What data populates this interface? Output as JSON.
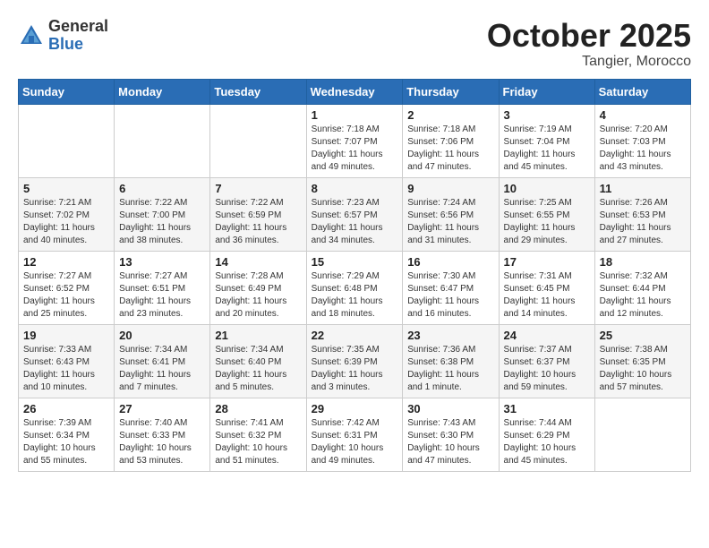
{
  "header": {
    "logo_general": "General",
    "logo_blue": "Blue",
    "month": "October 2025",
    "location": "Tangier, Morocco"
  },
  "weekdays": [
    "Sunday",
    "Monday",
    "Tuesday",
    "Wednesday",
    "Thursday",
    "Friday",
    "Saturday"
  ],
  "weeks": [
    [
      {
        "day": "",
        "info": ""
      },
      {
        "day": "",
        "info": ""
      },
      {
        "day": "",
        "info": ""
      },
      {
        "day": "1",
        "info": "Sunrise: 7:18 AM\nSunset: 7:07 PM\nDaylight: 11 hours\nand 49 minutes."
      },
      {
        "day": "2",
        "info": "Sunrise: 7:18 AM\nSunset: 7:06 PM\nDaylight: 11 hours\nand 47 minutes."
      },
      {
        "day": "3",
        "info": "Sunrise: 7:19 AM\nSunset: 7:04 PM\nDaylight: 11 hours\nand 45 minutes."
      },
      {
        "day": "4",
        "info": "Sunrise: 7:20 AM\nSunset: 7:03 PM\nDaylight: 11 hours\nand 43 minutes."
      }
    ],
    [
      {
        "day": "5",
        "info": "Sunrise: 7:21 AM\nSunset: 7:02 PM\nDaylight: 11 hours\nand 40 minutes."
      },
      {
        "day": "6",
        "info": "Sunrise: 7:22 AM\nSunset: 7:00 PM\nDaylight: 11 hours\nand 38 minutes."
      },
      {
        "day": "7",
        "info": "Sunrise: 7:22 AM\nSunset: 6:59 PM\nDaylight: 11 hours\nand 36 minutes."
      },
      {
        "day": "8",
        "info": "Sunrise: 7:23 AM\nSunset: 6:57 PM\nDaylight: 11 hours\nand 34 minutes."
      },
      {
        "day": "9",
        "info": "Sunrise: 7:24 AM\nSunset: 6:56 PM\nDaylight: 11 hours\nand 31 minutes."
      },
      {
        "day": "10",
        "info": "Sunrise: 7:25 AM\nSunset: 6:55 PM\nDaylight: 11 hours\nand 29 minutes."
      },
      {
        "day": "11",
        "info": "Sunrise: 7:26 AM\nSunset: 6:53 PM\nDaylight: 11 hours\nand 27 minutes."
      }
    ],
    [
      {
        "day": "12",
        "info": "Sunrise: 7:27 AM\nSunset: 6:52 PM\nDaylight: 11 hours\nand 25 minutes."
      },
      {
        "day": "13",
        "info": "Sunrise: 7:27 AM\nSunset: 6:51 PM\nDaylight: 11 hours\nand 23 minutes."
      },
      {
        "day": "14",
        "info": "Sunrise: 7:28 AM\nSunset: 6:49 PM\nDaylight: 11 hours\nand 20 minutes."
      },
      {
        "day": "15",
        "info": "Sunrise: 7:29 AM\nSunset: 6:48 PM\nDaylight: 11 hours\nand 18 minutes."
      },
      {
        "day": "16",
        "info": "Sunrise: 7:30 AM\nSunset: 6:47 PM\nDaylight: 11 hours\nand 16 minutes."
      },
      {
        "day": "17",
        "info": "Sunrise: 7:31 AM\nSunset: 6:45 PM\nDaylight: 11 hours\nand 14 minutes."
      },
      {
        "day": "18",
        "info": "Sunrise: 7:32 AM\nSunset: 6:44 PM\nDaylight: 11 hours\nand 12 minutes."
      }
    ],
    [
      {
        "day": "19",
        "info": "Sunrise: 7:33 AM\nSunset: 6:43 PM\nDaylight: 11 hours\nand 10 minutes."
      },
      {
        "day": "20",
        "info": "Sunrise: 7:34 AM\nSunset: 6:41 PM\nDaylight: 11 hours\nand 7 minutes."
      },
      {
        "day": "21",
        "info": "Sunrise: 7:34 AM\nSunset: 6:40 PM\nDaylight: 11 hours\nand 5 minutes."
      },
      {
        "day": "22",
        "info": "Sunrise: 7:35 AM\nSunset: 6:39 PM\nDaylight: 11 hours\nand 3 minutes."
      },
      {
        "day": "23",
        "info": "Sunrise: 7:36 AM\nSunset: 6:38 PM\nDaylight: 11 hours\nand 1 minute."
      },
      {
        "day": "24",
        "info": "Sunrise: 7:37 AM\nSunset: 6:37 PM\nDaylight: 10 hours\nand 59 minutes."
      },
      {
        "day": "25",
        "info": "Sunrise: 7:38 AM\nSunset: 6:35 PM\nDaylight: 10 hours\nand 57 minutes."
      }
    ],
    [
      {
        "day": "26",
        "info": "Sunrise: 7:39 AM\nSunset: 6:34 PM\nDaylight: 10 hours\nand 55 minutes."
      },
      {
        "day": "27",
        "info": "Sunrise: 7:40 AM\nSunset: 6:33 PM\nDaylight: 10 hours\nand 53 minutes."
      },
      {
        "day": "28",
        "info": "Sunrise: 7:41 AM\nSunset: 6:32 PM\nDaylight: 10 hours\nand 51 minutes."
      },
      {
        "day": "29",
        "info": "Sunrise: 7:42 AM\nSunset: 6:31 PM\nDaylight: 10 hours\nand 49 minutes."
      },
      {
        "day": "30",
        "info": "Sunrise: 7:43 AM\nSunset: 6:30 PM\nDaylight: 10 hours\nand 47 minutes."
      },
      {
        "day": "31",
        "info": "Sunrise: 7:44 AM\nSunset: 6:29 PM\nDaylight: 10 hours\nand 45 minutes."
      },
      {
        "day": "",
        "info": ""
      }
    ]
  ]
}
